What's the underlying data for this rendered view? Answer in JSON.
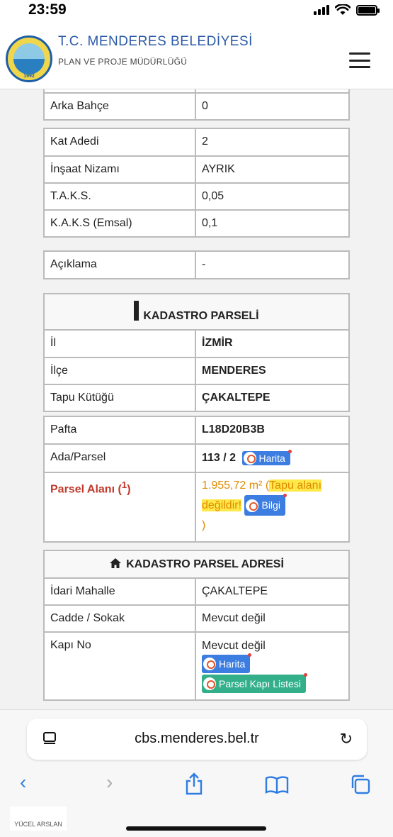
{
  "status": {
    "time": "23:59"
  },
  "header": {
    "title": "T.C. MENDERES BELEDİYESİ",
    "subtitle": "PLAN VE PROJE MÜDÜRLÜĞÜ",
    "logo_year": "1992",
    "logo_text": "MENDERES BELEDİYESİ"
  },
  "table_a": [
    {
      "label": "Arka Bahçe",
      "value": "0"
    }
  ],
  "table_b": [
    {
      "label": "Kat Adedi",
      "value": "2"
    },
    {
      "label": "İnşaat Nizamı",
      "value": "AYRIK"
    },
    {
      "label": "T.A.K.S.",
      "value": "0,05"
    },
    {
      "label": "K.A.K.S (Emsal)",
      "value": "0,1"
    }
  ],
  "table_c": [
    {
      "label": "Açıklama",
      "value": "-"
    }
  ],
  "kadastro": {
    "header": "KADASTRO PARSELİ",
    "il_label": "İl",
    "il_value": "İZMİR",
    "ilce_label": "İlçe",
    "ilce_value": "MENDERES",
    "tapu_label": "Tapu Kütüğü",
    "tapu_value": "ÇAKALTEPE",
    "pafta_label": "Pafta",
    "pafta_value": "L18D20B3B",
    "ada_label": "Ada/Parsel",
    "ada_value": "113 / 2",
    "harita_btn": "Harita",
    "alan_label": "Parsel Alanı (",
    "alan_label_sup": "1",
    "alan_label_close": ")",
    "alan_value": "1.955,72 m²",
    "alan_paren_open": " (",
    "alan_note": "Tapu alanı değildir!",
    "bilgi_btn": "Bilgi",
    "alan_paren_close": ")"
  },
  "adres": {
    "header": "KADASTRO PARSEL ADRESİ",
    "mahalle_label": "İdari Mahalle",
    "mahalle_value": "ÇAKALTEPE",
    "cadde_label": "Cadde / Sokak",
    "cadde_value": "Mevcut değil",
    "kapi_label": "Kapı No",
    "kapi_value": "Mevcut değil",
    "harita_btn": "Harita",
    "liste_btn": "Parsel Kapı Listesi"
  },
  "browser": {
    "url": "cbs.menderes.bel.tr"
  },
  "watermark": {
    "text": "YÜCEL ARSLAN"
  },
  "colors": {
    "brand_blue": "#2b5aa8",
    "button_blue": "#3b7de0",
    "button_teal": "#33b08a",
    "alert_red": "#c0392b",
    "highlight": "#ffe84a"
  }
}
